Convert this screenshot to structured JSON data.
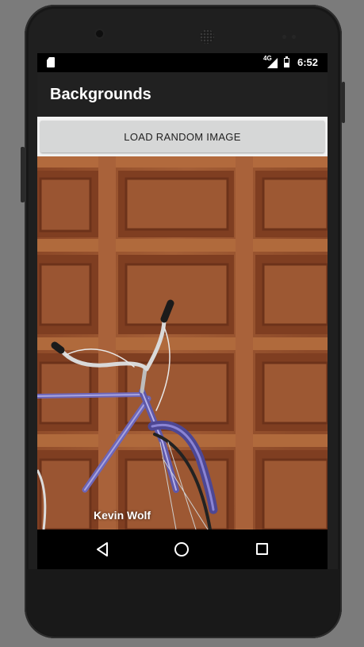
{
  "status_bar": {
    "network_label": "4G",
    "time": "6:52",
    "icons": [
      "sd-card-icon",
      "signal-icon",
      "battery-icon"
    ]
  },
  "app_bar": {
    "title": "Backgrounds"
  },
  "main": {
    "load_button_label": "LOAD RANDOM IMAGE"
  },
  "photo_credit": {
    "author_name": "Kevin Wolf"
  },
  "nav_bar": {
    "icons": [
      "back-icon",
      "home-icon",
      "recent-apps-icon"
    ]
  },
  "colors": {
    "app_bar": "#212121",
    "button": "#d6d7d7",
    "wood": "#96532d"
  }
}
